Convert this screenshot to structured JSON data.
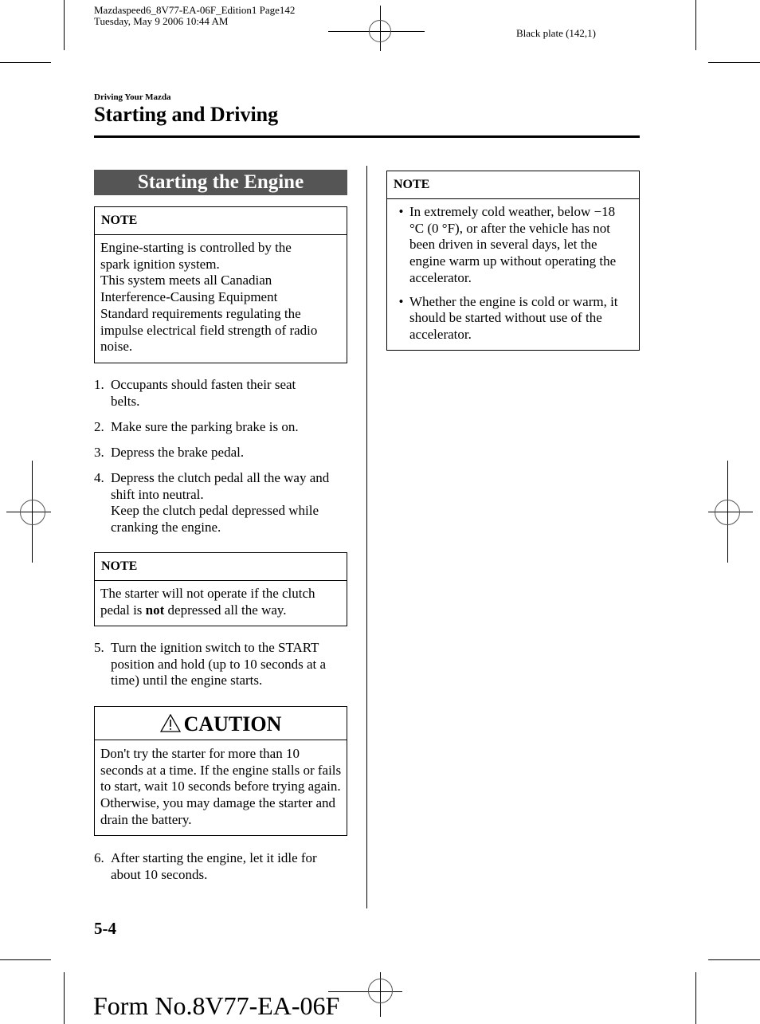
{
  "slug": {
    "line1": "Mazdaspeed6_8V77-EA-06F_Edition1 Page142",
    "line2": "Tuesday, May 9 2006 10:44 AM",
    "plate": "Black plate (142,1)"
  },
  "header": {
    "section": "Driving Your Mazda",
    "chapter": "Starting and Driving"
  },
  "topic": {
    "title": "Starting the Engine"
  },
  "note1": {
    "label": "NOTE",
    "lines": [
      "Engine-starting is controlled by the",
      "spark ignition system.",
      "This system meets all Canadian",
      "Interference-Causing Equipment",
      "Standard requirements regulating the",
      "impulse electrical field strength of radio",
      "noise."
    ]
  },
  "steps": [
    {
      "num": "1.",
      "text": "Occupants should fasten their seat belts."
    },
    {
      "num": "2.",
      "text": "Make sure the parking brake is on."
    },
    {
      "num": "3.",
      "text": "Depress the brake pedal."
    },
    {
      "num": "4.",
      "text": "Depress the clutch pedal all the way and shift into neutral.",
      "text2": "Keep the clutch pedal depressed while cranking the engine."
    },
    {
      "num": "5.",
      "text": "Turn the ignition switch to the START position and hold (up to 10 seconds at a time) until the engine starts."
    },
    {
      "num": "6.",
      "text": "After starting the engine, let it idle for about 10 seconds."
    }
  ],
  "note2": {
    "label": "NOTE",
    "before": "The starter will not operate if the clutch pedal is ",
    "bold": "not",
    "after": " depressed all the way."
  },
  "caution": {
    "icon": "warning-triangle-icon",
    "label": "CAUTION",
    "text": "Don't try the starter for more than 10 seconds at a time. If the engine stalls or fails to start, wait 10 seconds before trying again. Otherwise, you may damage the starter and drain the battery."
  },
  "note3": {
    "label": "NOTE",
    "bullets": [
      "In extremely cold weather, below −18 °C (0 °F), or after the vehicle has not been driven in several days, let the engine warm up without operating the accelerator.",
      "Whether the engine is cold or warm, it should be started without use of the accelerator."
    ]
  },
  "footer": {
    "page_number": "5-4",
    "form_number": "Form No.8V77-EA-06F"
  }
}
